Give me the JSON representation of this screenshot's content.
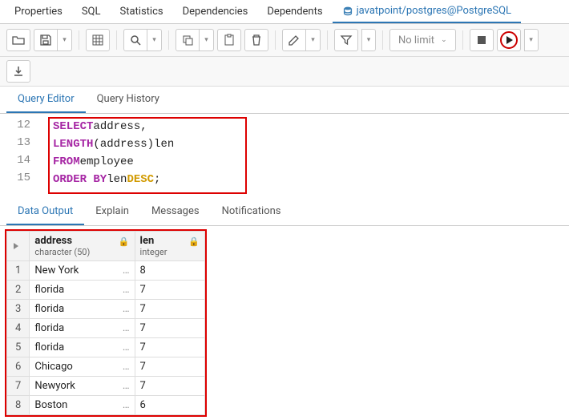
{
  "top_tabs": {
    "properties": "Properties",
    "sql": "SQL",
    "statistics": "Statistics",
    "dependencies": "Dependencies",
    "dependents": "Dependents",
    "connection": "javatpoint/postgres@PostgreSQL"
  },
  "toolbar": {
    "nolimit": "No limit"
  },
  "editor_tabs": {
    "query_editor": "Query Editor",
    "query_history": "Query History"
  },
  "editor": {
    "lines": [
      "12",
      "13",
      "14",
      "15"
    ],
    "l12_kw": "SELECT",
    "l12_rest": " address,",
    "l13_fn": "LENGTH",
    "l13_paren_open": "(",
    "l13_arg": "address",
    "l13_paren_close": ")",
    "l13_rest": " len",
    "l14_kw": "FROM",
    "l14_rest": " employee",
    "l15_kw": "ORDER BY",
    "l15_mid": " len ",
    "l15_desc": "DESC",
    "l15_semi": ";"
  },
  "output_tabs": {
    "data_output": "Data Output",
    "explain": "Explain",
    "messages": "Messages",
    "notifications": "Notifications"
  },
  "grid": {
    "col1_name": "address",
    "col1_type": "character (50)",
    "col2_name": "len",
    "col2_type": "integer",
    "rows": [
      {
        "n": "1",
        "address": "New York",
        "len": "8"
      },
      {
        "n": "2",
        "address": "florida",
        "len": "7"
      },
      {
        "n": "3",
        "address": "florida",
        "len": "7"
      },
      {
        "n": "4",
        "address": "florida",
        "len": "7"
      },
      {
        "n": "5",
        "address": "florida",
        "len": "7"
      },
      {
        "n": "6",
        "address": "Chicago",
        "len": "7"
      },
      {
        "n": "7",
        "address": "Newyork",
        "len": "7"
      },
      {
        "n": "8",
        "address": "Boston",
        "len": "6"
      }
    ]
  }
}
